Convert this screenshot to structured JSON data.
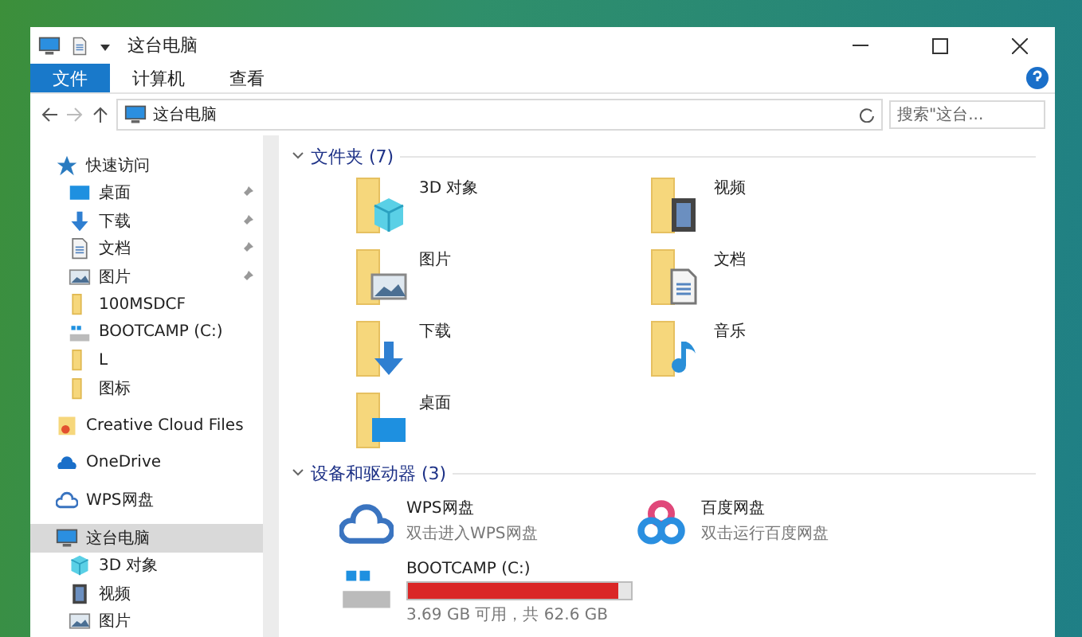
{
  "window": {
    "title": "这台电脑"
  },
  "ribbon": {
    "tabs": [
      {
        "label": "文件",
        "selected": true
      },
      {
        "label": "计算机",
        "selected": false
      },
      {
        "label": "查看",
        "selected": false
      }
    ]
  },
  "address": {
    "path": "这台电脑",
    "search_placeholder": "搜索\"这台..."
  },
  "nav": [
    {
      "label": "快速访问",
      "kind": "star",
      "selected": false,
      "children": [
        {
          "label": "桌面",
          "kind": "desktop",
          "pinned": true,
          "selected": false
        },
        {
          "label": "下载",
          "kind": "download",
          "pinned": true,
          "selected": false
        },
        {
          "label": "文档",
          "kind": "document",
          "pinned": true,
          "selected": false
        },
        {
          "label": "图片",
          "kind": "picture",
          "pinned": true,
          "selected": false
        },
        {
          "label": "100MSDCF",
          "kind": "folder",
          "pinned": false,
          "selected": false
        },
        {
          "label": "BOOTCAMP (C:)",
          "kind": "drive",
          "pinned": false,
          "selected": false
        },
        {
          "label": "L",
          "kind": "folder",
          "pinned": false,
          "selected": false
        },
        {
          "label": "图标",
          "kind": "folder",
          "pinned": false,
          "selected": false
        }
      ]
    },
    {
      "label": "Creative Cloud Files",
      "kind": "cc",
      "selected": false
    },
    {
      "label": "OneDrive",
      "kind": "onedrive",
      "selected": false
    },
    {
      "label": "WPS网盘",
      "kind": "cloud",
      "selected": false
    },
    {
      "label": "这台电脑",
      "kind": "pc",
      "selected": true,
      "children": [
        {
          "label": "3D 对象",
          "kind": "cube",
          "pinned": false,
          "selected": false
        },
        {
          "label": "视频",
          "kind": "video",
          "pinned": false,
          "selected": false
        },
        {
          "label": "图片",
          "kind": "picture",
          "pinned": false,
          "selected": false
        }
      ]
    }
  ],
  "folders": {
    "title": "文件夹 (7)",
    "expanded": true,
    "items": [
      {
        "label": "3D 对象",
        "kind": "cube"
      },
      {
        "label": "视频",
        "kind": "video"
      },
      {
        "label": "图片",
        "kind": "picture"
      },
      {
        "label": "文档",
        "kind": "document"
      },
      {
        "label": "下载",
        "kind": "download"
      },
      {
        "label": "音乐",
        "kind": "music"
      },
      {
        "label": "桌面",
        "kind": "desktop"
      }
    ]
  },
  "devices": {
    "title": "设备和驱动器 (3)",
    "expanded": true,
    "items": [
      {
        "kind": "cloud",
        "label": "WPS网盘",
        "subtitle": "双击进入WPS网盘"
      },
      {
        "kind": "baidu",
        "label": "百度网盘",
        "subtitle": "双击运行百度网盘"
      },
      {
        "kind": "drive",
        "label": "BOOTCAMP (C:)",
        "level": 0.94,
        "subtitle": "3.69 GB 可用，共 62.6 GB"
      }
    ]
  }
}
